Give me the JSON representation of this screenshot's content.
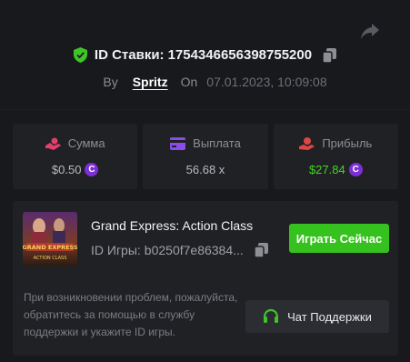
{
  "bet": {
    "id_label": "ID Ставки:",
    "id_value": "1754346656398755200",
    "by_label": "By",
    "user": "Spritz",
    "on_label": "On",
    "date": "07.01.2023, 10:09:08"
  },
  "stats": [
    {
      "label": "Сумма",
      "value": "$0.50",
      "coin": true,
      "icon": "wager-icon"
    },
    {
      "label": "Выплата",
      "value": "56.68 x",
      "coin": false,
      "icon": "card-icon"
    },
    {
      "label": "Прибыль",
      "value": "$27.84",
      "coin": true,
      "icon": "profit-icon"
    }
  ],
  "coin_symbol": "C",
  "game": {
    "title": "Grand Express: Action Class",
    "id_label": "ID Игры:",
    "id_value": "b0250f7e86384...",
    "thumb_text_1": "GRAND EXPRESS",
    "thumb_text_2": "ACTION CLASS",
    "play_label": "Играть Сейчас"
  },
  "support": {
    "text": "При возникновении проблем, пожалуйста, обратитесь за помощью в службу поддержки и укажите ID игры.",
    "chat_label": "Чат Поддержки"
  },
  "colors": {
    "accent_green": "#36c21e",
    "profit_green": "#45d326",
    "wager_pink": "#e0406b",
    "payout_purple": "#8a4ce8",
    "profit_red": "#e04545",
    "coin_purple": "#7d2fd6"
  }
}
